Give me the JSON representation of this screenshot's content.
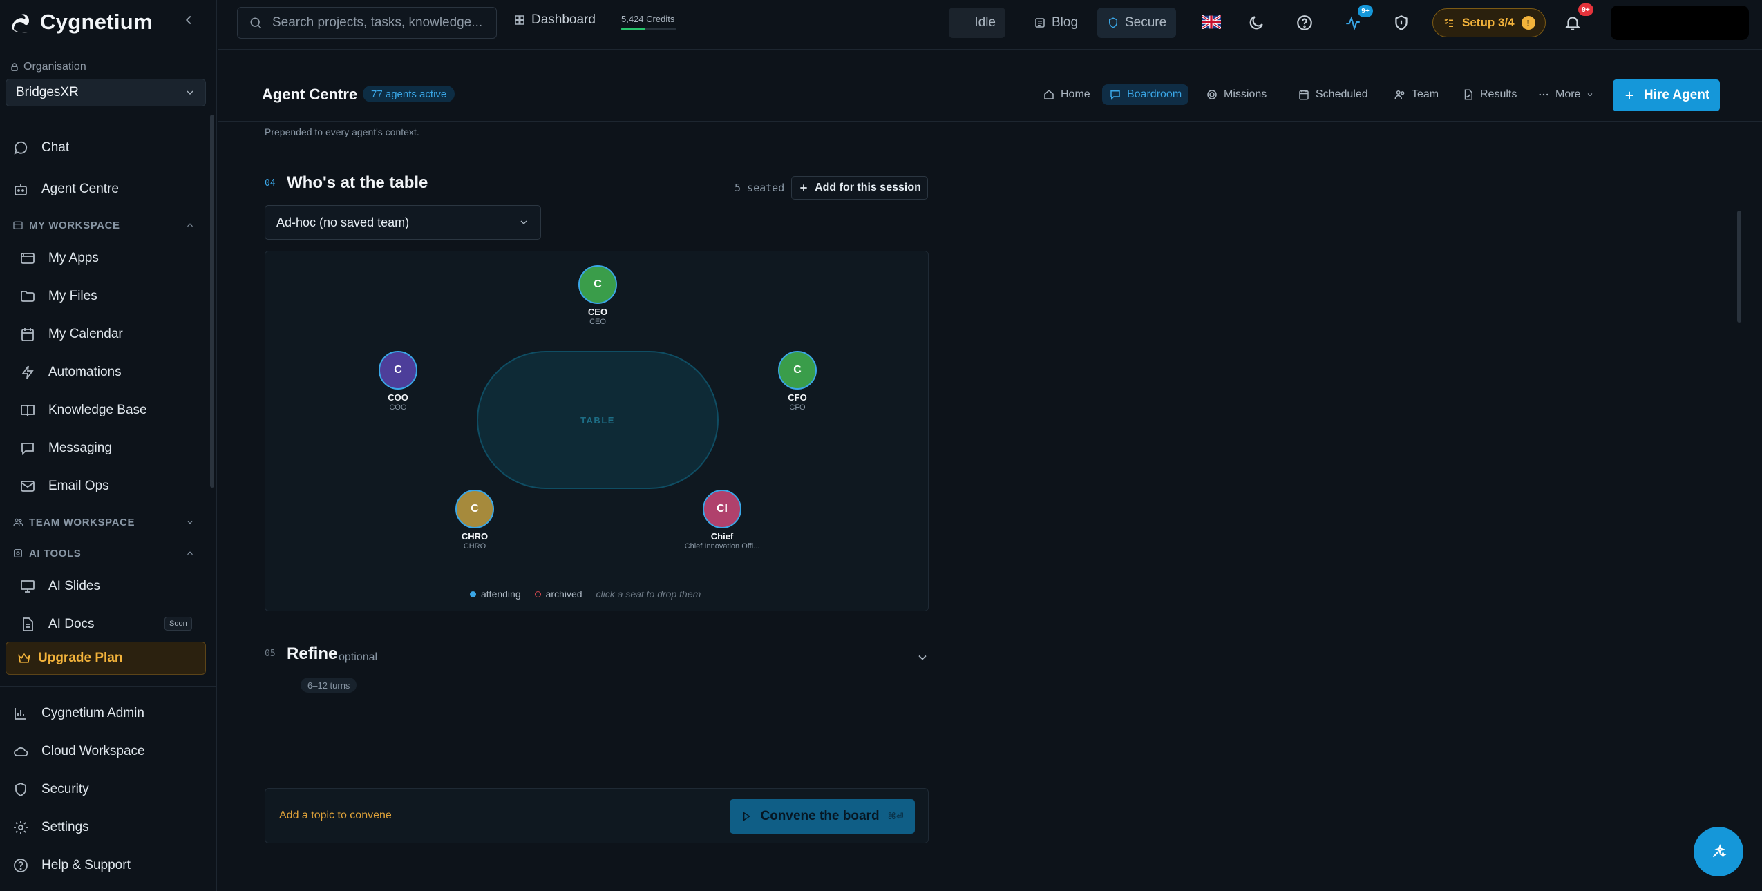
{
  "app": {
    "name": "Cygnetium"
  },
  "sidebar": {
    "org_label": "Organisation",
    "org_value": "BridgesXR",
    "items_top": [
      {
        "label": "Chat",
        "icon": "chat-icon"
      },
      {
        "label": "Agent Centre",
        "icon": "robot-icon"
      }
    ],
    "my_workspace": {
      "title": "MY WORKSPACE",
      "items": [
        {
          "label": "My Apps",
          "icon": "apps-icon"
        },
        {
          "label": "My Files",
          "icon": "folder-icon"
        },
        {
          "label": "My Calendar",
          "icon": "calendar-icon"
        },
        {
          "label": "Automations",
          "icon": "bolt-icon"
        },
        {
          "label": "Knowledge Base",
          "icon": "book-icon"
        },
        {
          "label": "Messaging",
          "icon": "message-icon"
        },
        {
          "label": "Email Ops",
          "icon": "mail-icon"
        }
      ]
    },
    "team_workspace": {
      "title": "TEAM WORKSPACE"
    },
    "ai_tools": {
      "title": "AI TOOLS",
      "items": [
        {
          "label": "AI Slides",
          "icon": "slides-icon"
        },
        {
          "label": "AI Docs",
          "icon": "doc-icon",
          "badge": "Soon"
        }
      ]
    },
    "upgrade_label": "Upgrade Plan",
    "bottom_items": [
      {
        "label": "Cygnetium Admin",
        "icon": "chart-icon"
      },
      {
        "label": "Cloud Workspace",
        "icon": "cloud-icon"
      },
      {
        "label": "Security",
        "icon": "shield-icon"
      },
      {
        "label": "Settings",
        "icon": "gear-icon"
      },
      {
        "label": "Help & Support",
        "icon": "help-icon"
      }
    ]
  },
  "topbar": {
    "search_placeholder": "Search projects, tasks, knowledge...",
    "dashboard_label": "Dashboard",
    "credits_text": "5,424 Credits",
    "credits_fraction": 0.44,
    "idle_label": "Idle",
    "blog_label": "Blog",
    "secure_label": "Secure",
    "activity_badge": "9+",
    "setup_label": "Setup 3/4",
    "setup_badge": "!",
    "notif_badge": "9+"
  },
  "subheader": {
    "title": "Agent Centre",
    "agents_badge": "77 agents active",
    "tabs": [
      {
        "label": "Home",
        "icon": "home-icon"
      },
      {
        "label": "Boardroom",
        "icon": "boardroom-icon",
        "active": true
      },
      {
        "label": "Missions",
        "icon": "target-icon"
      },
      {
        "label": "Scheduled",
        "icon": "calendar-icon"
      },
      {
        "label": "Team",
        "icon": "team-icon"
      },
      {
        "label": "Results",
        "icon": "results-icon"
      },
      {
        "label": "More",
        "icon": "more-icon"
      }
    ],
    "hire_label": "Hire Agent"
  },
  "main": {
    "prepend_note": "Prepended to every agent's context.",
    "step4": {
      "num": "04",
      "title": "Who's at the table",
      "seated": "5 seated",
      "add_label": "Add for this session"
    },
    "team_select": "Ad-hoc (no saved team)",
    "table_label": "TABLE",
    "seats": [
      {
        "initials": "C",
        "name": "CEO",
        "role": "CEO",
        "color": "#3a9d4a"
      },
      {
        "initials": "C",
        "name": "COO",
        "role": "COO",
        "color": "#4d3e9a"
      },
      {
        "initials": "C",
        "name": "CFO",
        "role": "CFO",
        "color": "#3a9d4a"
      },
      {
        "initials": "C",
        "name": "CHRO",
        "role": "CHRO",
        "color": "#a68a3c"
      },
      {
        "initials": "CI",
        "name": "Chief",
        "role": "Chief Innovation Offi...",
        "color": "#b0416c"
      }
    ],
    "legend": {
      "attending": "attending",
      "archived": "archived",
      "hint": "click a seat to drop them"
    },
    "step5": {
      "num": "05",
      "title": "Refine",
      "optional": "optional",
      "turns": "6–12 turns"
    },
    "composer_placeholder": "Add a topic to convene",
    "convene_label": "Convene the board",
    "convene_kbd": "⌘⏎"
  },
  "colors": {
    "accent": "#1597d9",
    "warning": "#f3b33b",
    "success": "#27c36b"
  }
}
